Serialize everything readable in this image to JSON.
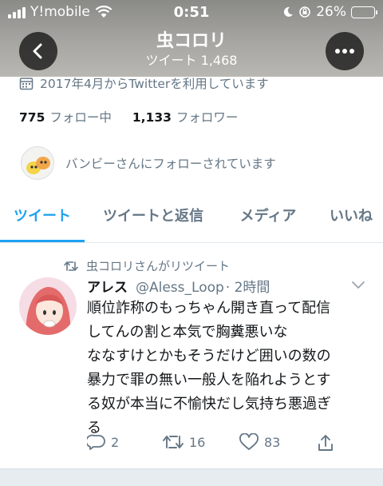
{
  "status_bar": {
    "carrier": "Y!mobile",
    "time": "0:51",
    "battery": "26%"
  },
  "header": {
    "title": "虫コロリ",
    "subtitle": "ツイート 1,468"
  },
  "profile": {
    "joined": "2017年4月からTwitterを利用しています",
    "following_count": "775",
    "following_label": "フォロー中",
    "followers_count": "1,133",
    "followers_label": "フォロワー",
    "followed_by": "バンビーさんにフォローされています"
  },
  "tabs": [
    {
      "label": "ツイート",
      "active": true
    },
    {
      "label": "ツイートと返信",
      "active": false
    },
    {
      "label": "メディア",
      "active": false
    },
    {
      "label": "いいね",
      "active": false
    }
  ],
  "tweet": {
    "retweeted_by": "虫コロリさんがリツイート",
    "name": "アレス",
    "handle": "@Aless_Loop",
    "time": "· 2時間",
    "lines": [
      "順位詐称のもっちゃん開き直って配信",
      "してんの割と本気で胸糞悪いな",
      "ななすけとかもそうだけど囲いの数の",
      "暴力で罪の無い一般人を陥れようとす",
      "る奴が本当に不愉快だし気持ち悪過ぎ",
      "る"
    ],
    "replies": "2",
    "retweets": "16",
    "likes": "83"
  },
  "colors": {
    "accent": "#1da1f2",
    "secondary_text": "#657786",
    "battery_fill": "#4cd964"
  }
}
